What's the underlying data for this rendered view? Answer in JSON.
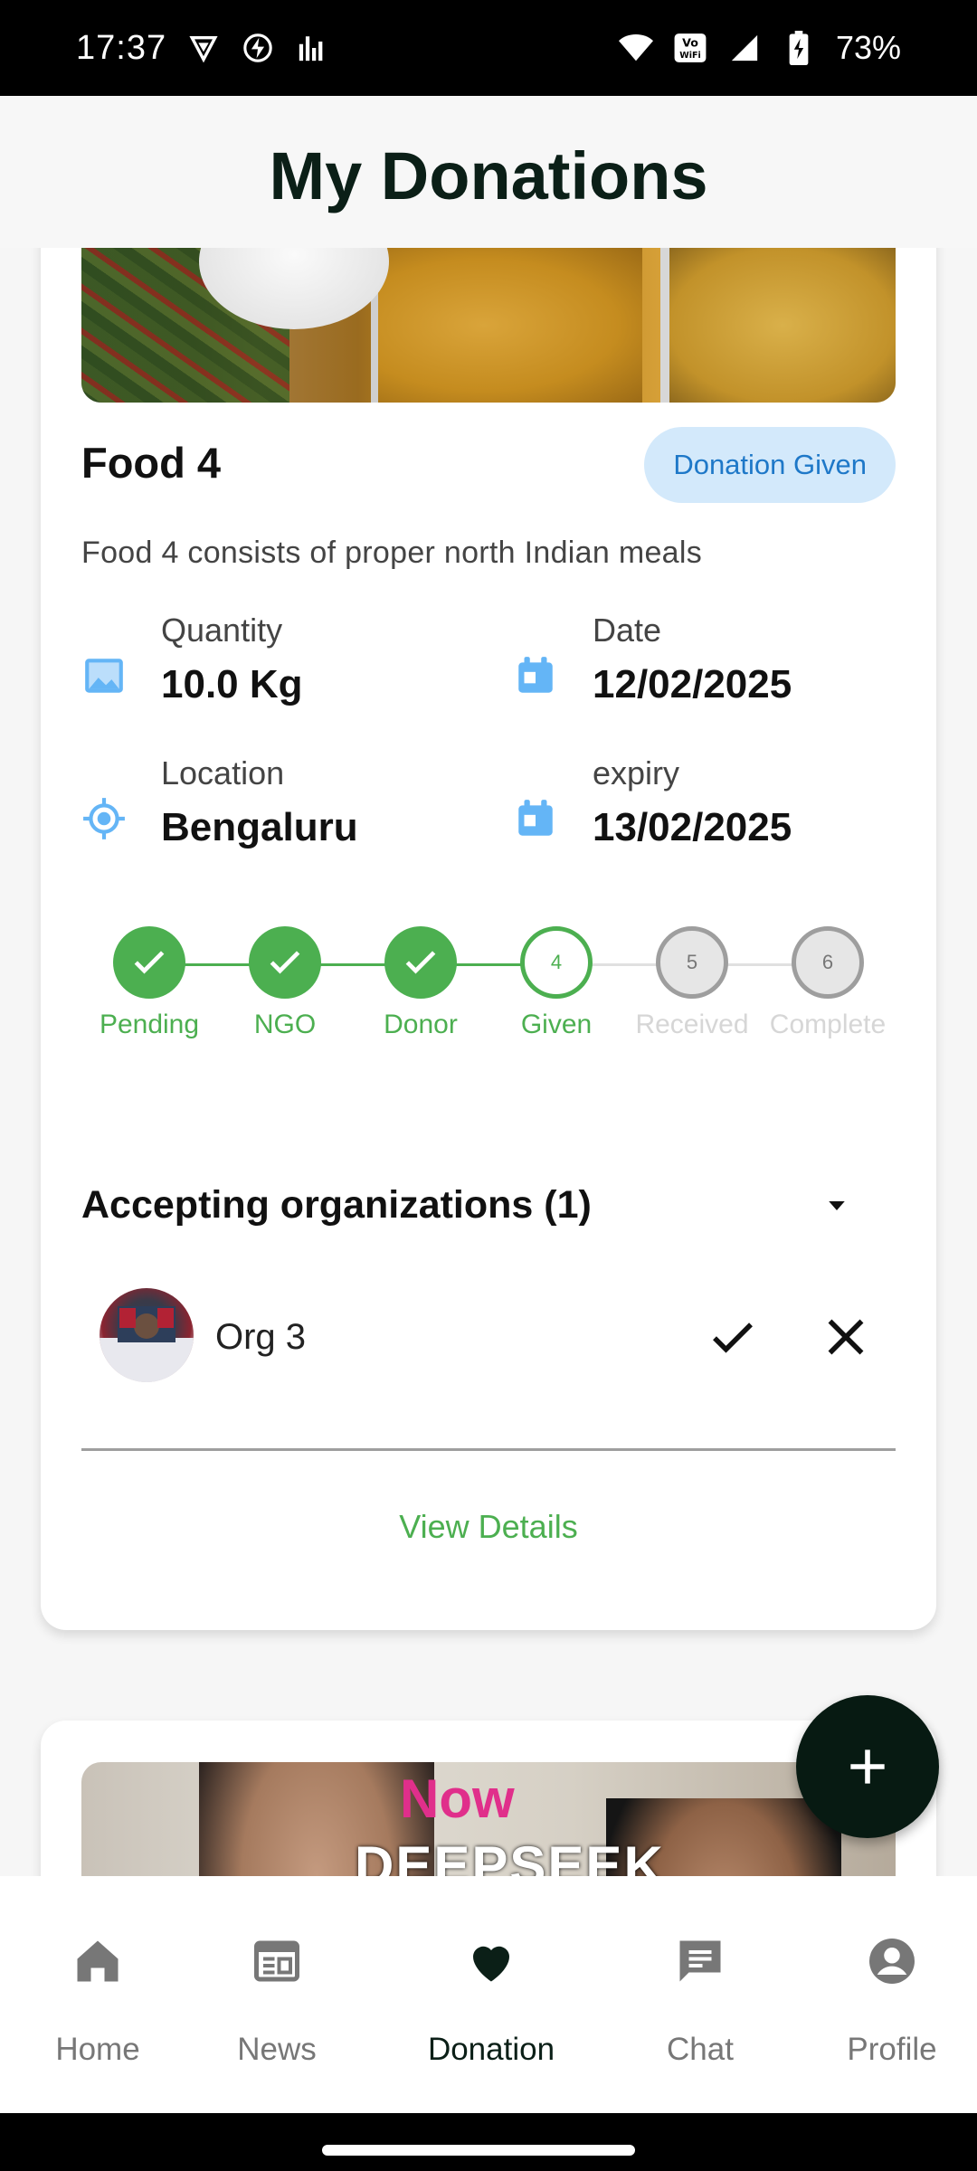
{
  "status_bar": {
    "time": "17:37",
    "battery": "73%"
  },
  "header": {
    "title": "My Donations"
  },
  "donation_card": {
    "name": "Food 4",
    "status_chip": "Donation Given",
    "description": "Food 4 consists of proper north Indian meals",
    "quantity": {
      "label": "Quantity",
      "value": "10.0 Kg"
    },
    "date": {
      "label": "Date",
      "value": "12/02/2025"
    },
    "location": {
      "label": "Location",
      "value": "Bengaluru"
    },
    "expiry": {
      "label": "expiry",
      "value": "13/02/2025"
    },
    "steps": [
      {
        "label": "Pending",
        "state": "done"
      },
      {
        "label": "NGO",
        "state": "done"
      },
      {
        "label": "Donor",
        "state": "done"
      },
      {
        "label": "Given",
        "number": "4",
        "state": "active"
      },
      {
        "label": "Received",
        "number": "5",
        "state": "todo"
      },
      {
        "label": "Complete",
        "number": "6",
        "state": "todo"
      }
    ],
    "accepting_title": "Accepting organizations (1)",
    "organizations": [
      {
        "name": "Org 3"
      }
    ],
    "view_details": "View Details"
  },
  "second_card": {
    "meme_text_top": "Now",
    "meme_text_bottom": "DEEPSEEK"
  },
  "bottom_nav": {
    "items": [
      {
        "label": "Home",
        "icon": "home-icon"
      },
      {
        "label": "News",
        "icon": "news-icon"
      },
      {
        "label": "Donation",
        "icon": "heart-icon",
        "active": true
      },
      {
        "label": "Chat",
        "icon": "chat-icon"
      },
      {
        "label": "Profile",
        "icon": "profile-icon"
      }
    ]
  },
  "colors": {
    "primary_green": "#4caf50",
    "dark": "#0b1f17",
    "chip_bg": "#d3e9fb",
    "chip_text": "#1e78c8",
    "info_icon": "#64b5f6"
  }
}
